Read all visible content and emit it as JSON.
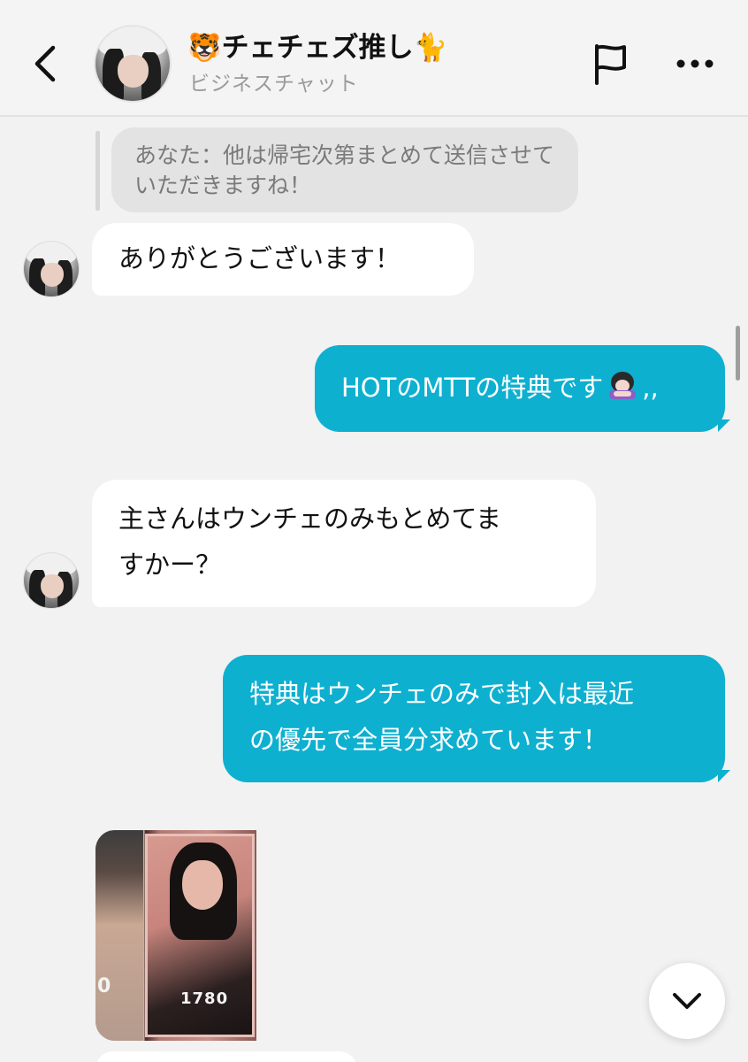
{
  "header": {
    "title": "🐯チェチェズ推し🐈",
    "subtitle": "ビジネスチャット"
  },
  "messages": {
    "reply_quote": "あなた：他は帰宅次第まとめて送信させていただきますね！",
    "m1": "ありがとうございます！",
    "m2_text": "HOTのMTTの特典です",
    "m2_suffix": ",,",
    "m3_line1": "主さんはウンチェのみもとめてま",
    "m3_line2": "すかー？",
    "m4_line1": "特典はウンチェのみで封入は最近",
    "m4_line2": "の優先で全員分求めています！"
  },
  "photo": {
    "number_label": "1780",
    "left_label": "0"
  },
  "colors": {
    "outgoing_bubble": "#0eb0d0",
    "incoming_bubble": "#ffffff",
    "background": "#f2f2f2"
  },
  "icons": {
    "back": "chevron-left-icon",
    "report": "flag-icon",
    "more": "ellipsis-icon",
    "scroll_down": "chevron-down-icon"
  }
}
